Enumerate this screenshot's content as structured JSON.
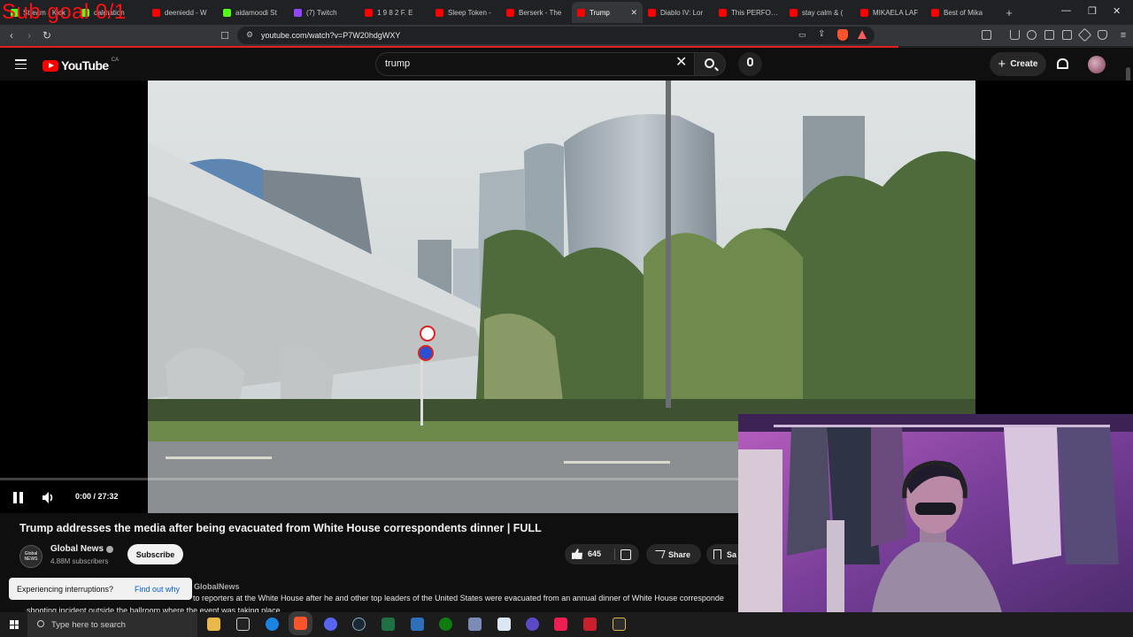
{
  "browser": {
    "tabs": [
      {
        "label": "Stream - Kick",
        "color": "#53fc18"
      },
      {
        "label": "dalmation",
        "color": "#53fc18"
      },
      {
        "label": "deeniedd - W",
        "color": "#ff0000"
      },
      {
        "label": "aidamoodi St",
        "color": "#53fc18"
      },
      {
        "label": "(7) Twitch",
        "color": "#9146ff"
      },
      {
        "label": "1 9 8 2   F. E",
        "color": "#ff0000"
      },
      {
        "label": "Sleep Token -",
        "color": "#ff0000"
      },
      {
        "label": "Berserk - The",
        "color": "#ff0000"
      },
      {
        "label": "Trump",
        "color": "#ff0000",
        "active": true
      },
      {
        "label": "Diablo IV: Lor",
        "color": "#ff0000"
      },
      {
        "label": "This PERFORM",
        "color": "#ff0000"
      },
      {
        "label": "stay calm & (",
        "color": "#ff0000"
      },
      {
        "label": "MIKAELA LAF",
        "color": "#ff0000"
      },
      {
        "label": "Best of Mika",
        "color": "#ff0000"
      }
    ],
    "url": "youtube.com/watch?v=P7W20hdgWXY"
  },
  "youtube": {
    "logo_text": "YouTube",
    "country_code": "CA",
    "search_value": "trump",
    "create_label": "Create"
  },
  "player": {
    "time": "0:00 / 27:32",
    "progress": 0
  },
  "video": {
    "title": "Trump addresses the media after being evacuated from White House correspondents dinner | FULL",
    "channel_name": "Global News",
    "channel_logo_text": "Global NEWS",
    "subscribers": "4.88M subscribers",
    "subscribe_label": "Subscribe",
    "like_count": "645",
    "share_label": "Share",
    "save_label": "Sa",
    "desc_channel": "GlobalNews",
    "desc_line1": "to reporters at the White House after he and other top leaders of the United States were evacuated from an annual dinner of White House corresponde",
    "desc_line2": "shooting incident outside the ballroom where the event was taking place."
  },
  "toast": {
    "message": "Experiencing interruptions?",
    "link": "Find out why"
  },
  "overlay": {
    "sub_goal": "Sub goal 0/1"
  },
  "taskbar": {
    "search_placeholder": "Type here to search",
    "apps": [
      "file-explorer",
      "epic-games",
      "edge",
      "brave",
      "discord",
      "steam",
      "spreadsheet",
      "window-app",
      "xbox",
      "shield-app",
      "notepad",
      "messenger",
      "tiktok",
      "media-app",
      "powershell"
    ]
  },
  "colors": {
    "accent_red": "#ff0000",
    "overlay_text": "#ff1010",
    "background": "#0f0f0f"
  }
}
